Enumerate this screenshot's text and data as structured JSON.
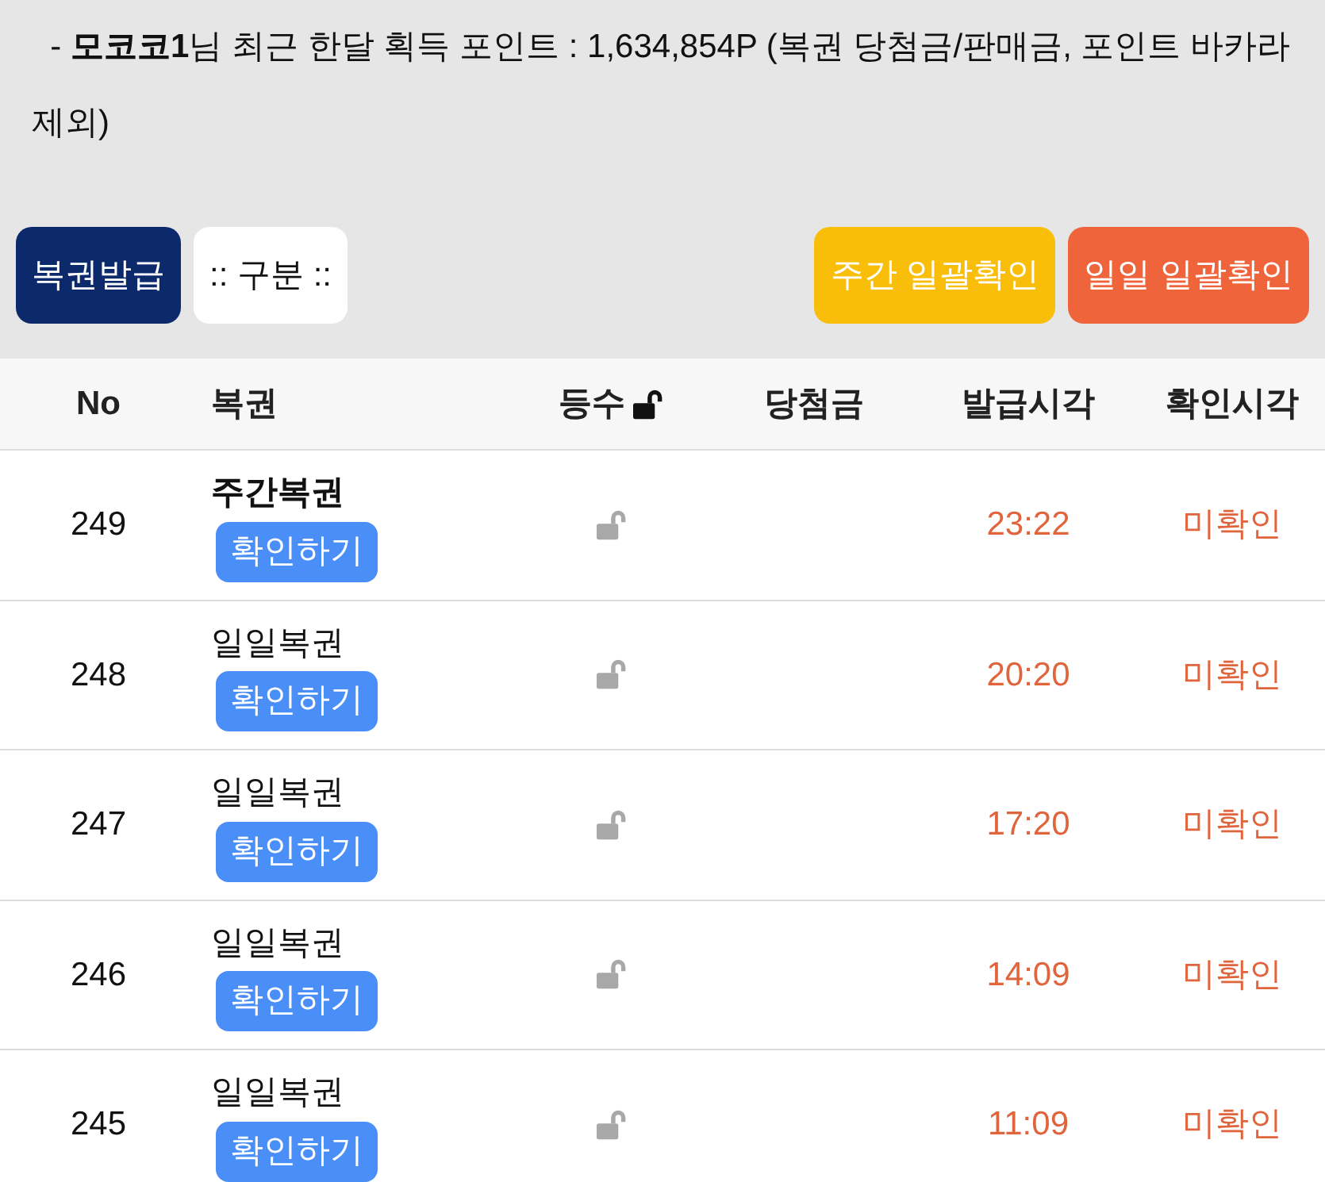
{
  "notice": "- **모코코1**님 최근 한달 획득 포인트 : 1,634,854P (복권 당첨금/판매금, 포인트 바카라 제외)",
  "buttons_left": [
    {
      "label": "복권발급",
      "kind": "primary"
    },
    {
      "label": ":: 구분 ::",
      "kind": "select"
    }
  ],
  "buttons_right": [
    {
      "label": "주간 일괄확인",
      "kind": "weekly"
    },
    {
      "label": "일일 일괄확인",
      "kind": "daily"
    }
  ],
  "table": {
    "columns": [
      "No",
      "복권",
      "등수",
      "당첨금",
      "발급시각",
      "확인시각"
    ],
    "rows": [
      {
        "no": "249",
        "name": "주간복권",
        "kind": "weekly",
        "action": "확인하기",
        "issued": "23:22",
        "status": "미확인"
      },
      {
        "no": "248",
        "name": "일일복권",
        "kind": "daily",
        "action": "확인하기",
        "issued": "20:20",
        "status": "미확인"
      },
      {
        "no": "247",
        "name": "일일복권",
        "kind": "daily",
        "action": "확인하기",
        "issued": "17:20",
        "status": "미확인"
      },
      {
        "no": "246",
        "name": "일일복권",
        "kind": "daily",
        "action": "확인하기",
        "issued": "14:09",
        "status": "미확인"
      },
      {
        "no": "245",
        "name": "일일복권",
        "kind": "daily",
        "action": "확인하기",
        "issued": "11:09",
        "status": "미확인"
      }
    ]
  }
}
